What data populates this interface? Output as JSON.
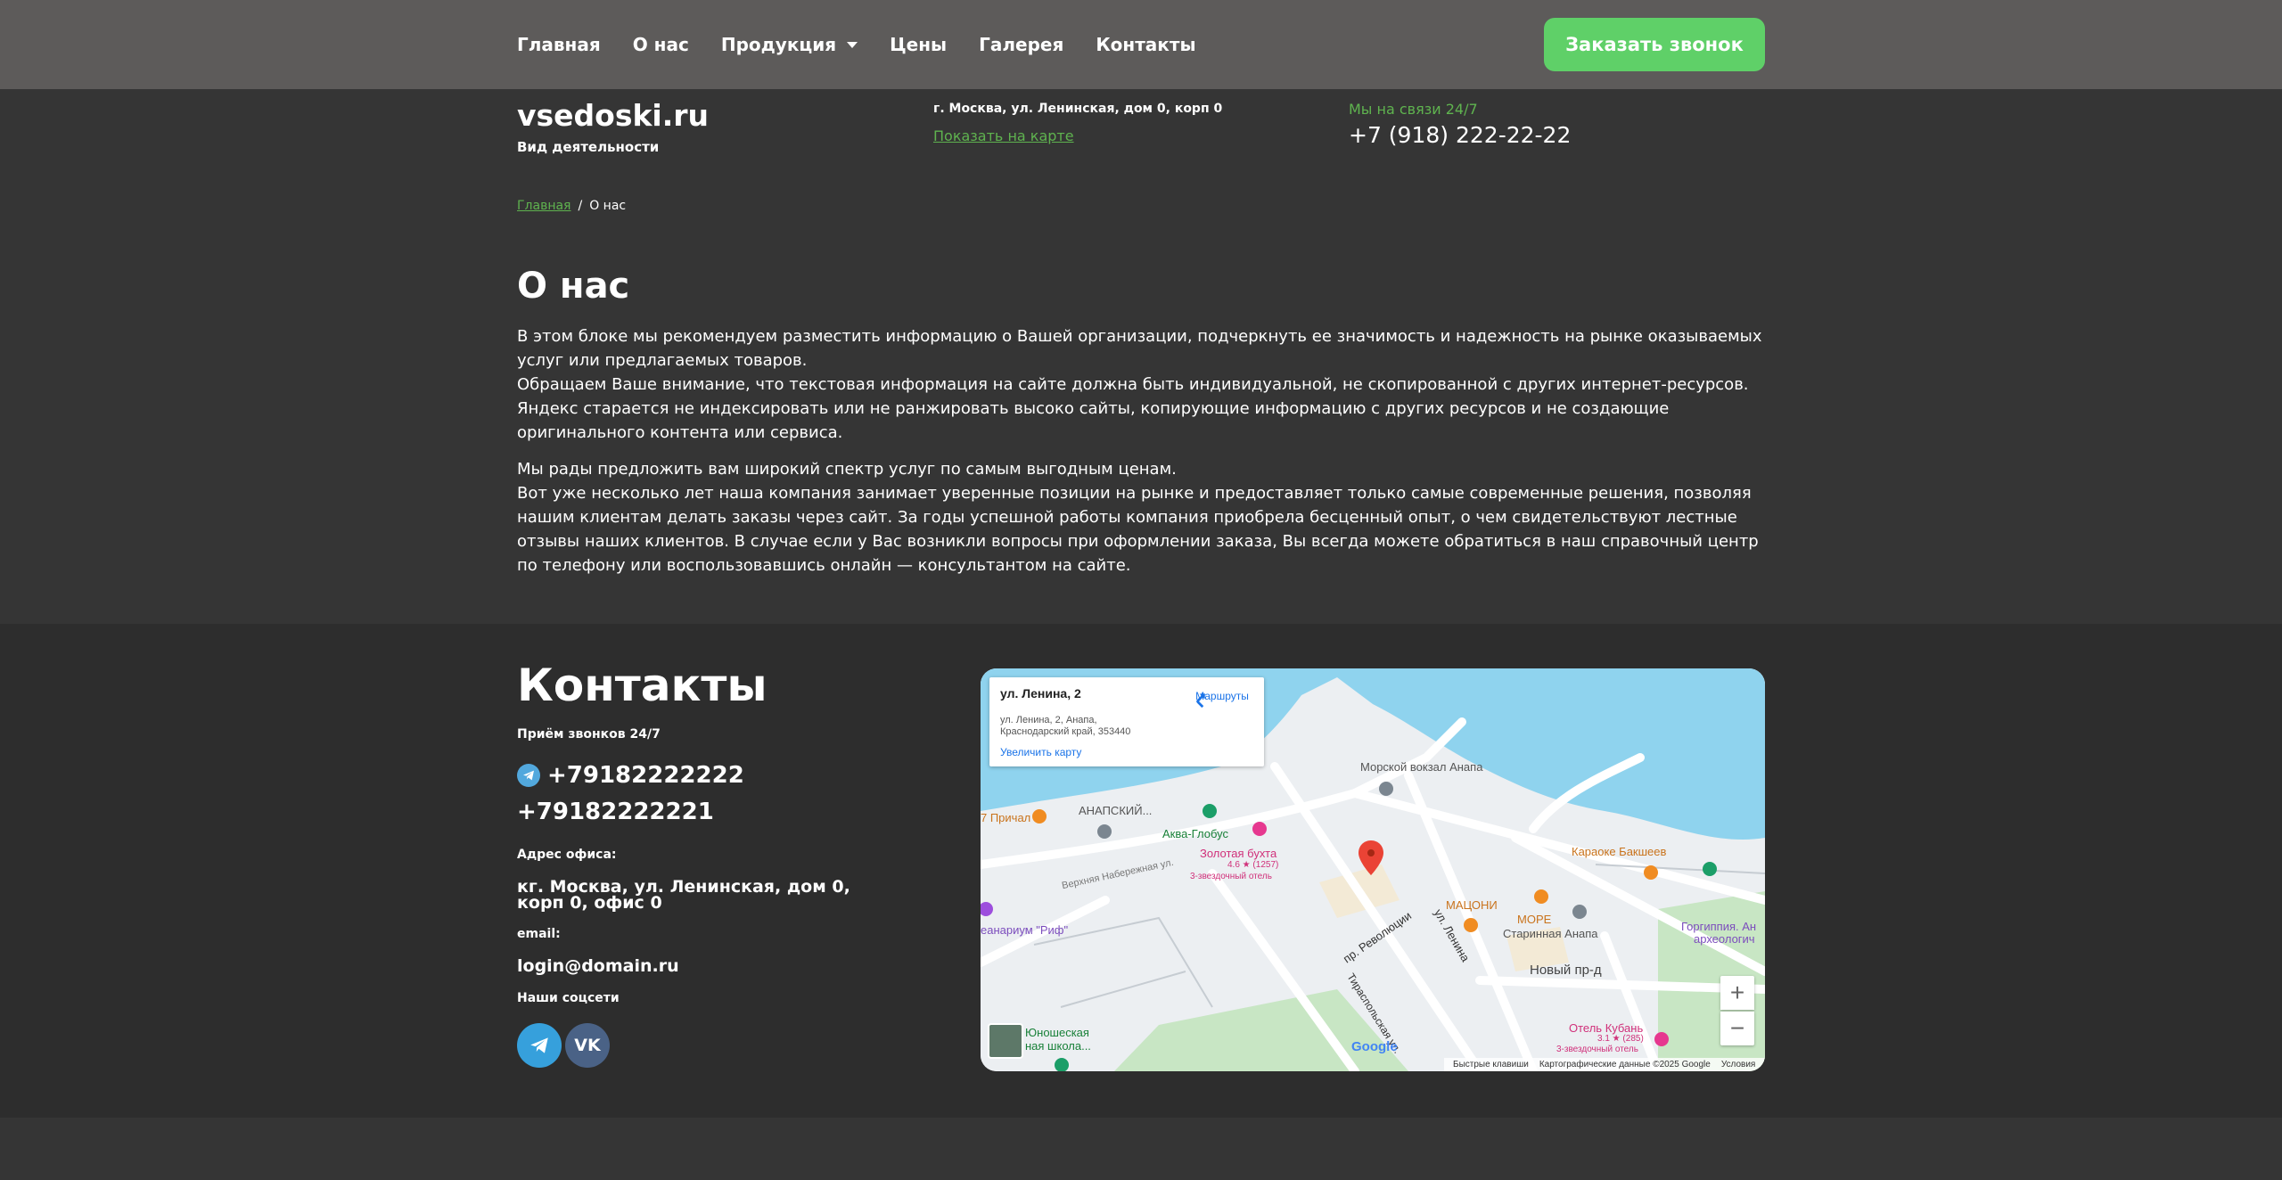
{
  "nav": {
    "items": [
      {
        "label": "Главная"
      },
      {
        "label": "О нас"
      },
      {
        "label": "Продукция",
        "dropdown": true
      },
      {
        "label": "Цены"
      },
      {
        "label": "Галерея"
      },
      {
        "label": "Контакты"
      }
    ],
    "cta_label": "Заказать звонок"
  },
  "header": {
    "site_name": "vsedoski.ru",
    "subtitle": "Вид деятельности",
    "address": "г. Москва, ул. Ленинская, дом 0, корп 0",
    "map_link": "Показать на карте",
    "online_label": "Мы на связи 24/7",
    "phone": "+7 (918) 222-22-22"
  },
  "breadcrumb": {
    "home": "Главная",
    "separator": "/",
    "current": "О нас"
  },
  "about": {
    "title": "О нас",
    "para1": [
      "В этом блоке мы рекомендуем разместить информацию о Вашей организации, подчеркнуть ее значимость и надежность на рынке оказываемых услуг или предлагаемых товаров.",
      "Обращаем Ваше внимание, что текстовая информация на сайте должна быть индивидуальной, не скопированной с других интернет-ресурсов. Яндекс старается не индексировать или не ранжировать высоко сайты, копирующие информацию с других ресурсов и не создающие оригинального контента или сервиса."
    ],
    "para2": [
      "Мы рады предложить вам широкий спектр услуг по самым выгодным ценам.",
      "Вот уже несколько лет наша компания занимает уверенные позиции на рынке и предоставляет только самые современные решения, позволяя нашим клиентам делать заказы через сайт. За годы успешной работы компания приобрела бесценный опыт, о чем свидетельствуют лестные отзывы наших клиентов. В случае если у Вас возникли вопросы при оформлении заказа, Вы всегда можете обратиться в наш справочный центр по телефону или воспользовавшись онлайн — консультантом на сайте."
    ]
  },
  "contacts": {
    "title": "Контакты",
    "hours_label": "Приём звонков 24/7",
    "phone1": "+79182222222",
    "phone2": "+79182222221",
    "address_label": "Адрес офиса:",
    "address": "кг. Москва, ул. Ленинская, дом 0, корп 0, офис 0",
    "email_label": "email:",
    "email": "login@domain.ru",
    "social_label": "Наши соцсети",
    "social": [
      {
        "icon": "telegram-icon",
        "color": "#36a0dc"
      },
      {
        "icon": "vk-icon",
        "color": "#4a6286",
        "glyph": "VK"
      }
    ]
  },
  "map": {
    "card_title": "ул. Ленина, 2",
    "card_address": "ул. Ленина, 2, Анапа, Краснодарский край, 353440",
    "route_label": "Маршруты",
    "enlarge_label": "Увеличить карту",
    "labels": [
      {
        "text": "Морской вокзал Анапа"
      },
      {
        "text": "АНАПСКИЙ..."
      },
      {
        "text": "7 Причал"
      },
      {
        "text": "Аква-Глобус"
      },
      {
        "text": "Золотая бухта"
      },
      {
        "text": "4.6 ★ (1257)"
      },
      {
        "text": "3-звездочный отель"
      },
      {
        "text": "Верхняя Набережная ул."
      },
      {
        "text": "Караоке Бакшеев"
      },
      {
        "text": "МАЦОНИ"
      },
      {
        "text": "МОРЕ"
      },
      {
        "text": "Старинная Анапа"
      },
      {
        "text": "Горгиппия. Ан"
      },
      {
        "text": "археологич"
      },
      {
        "text": "еанариум \"Риф\""
      },
      {
        "text": "пр. Революции"
      },
      {
        "text": "ул. Ленина"
      },
      {
        "text": "Новый пр-д"
      },
      {
        "text": "Тираспольская ул."
      },
      {
        "text": "Отель Кубань"
      },
      {
        "text": "3.1 ★ (285)"
      },
      {
        "text": "3-звездочный отель"
      },
      {
        "text": "Юношеская"
      },
      {
        "text": "ная школа..."
      }
    ],
    "google": "Google",
    "attribution": [
      "Быстрые клавиши",
      "Картографические данные ©2025 Google",
      "Условия"
    ],
    "zoom_in": "+",
    "zoom_out": "−",
    "colors": {
      "water": "#8fd3ee",
      "road": "#ffffff",
      "land": "#eceff2",
      "park": "#c8e6c4",
      "accent": "#5fd068"
    }
  }
}
